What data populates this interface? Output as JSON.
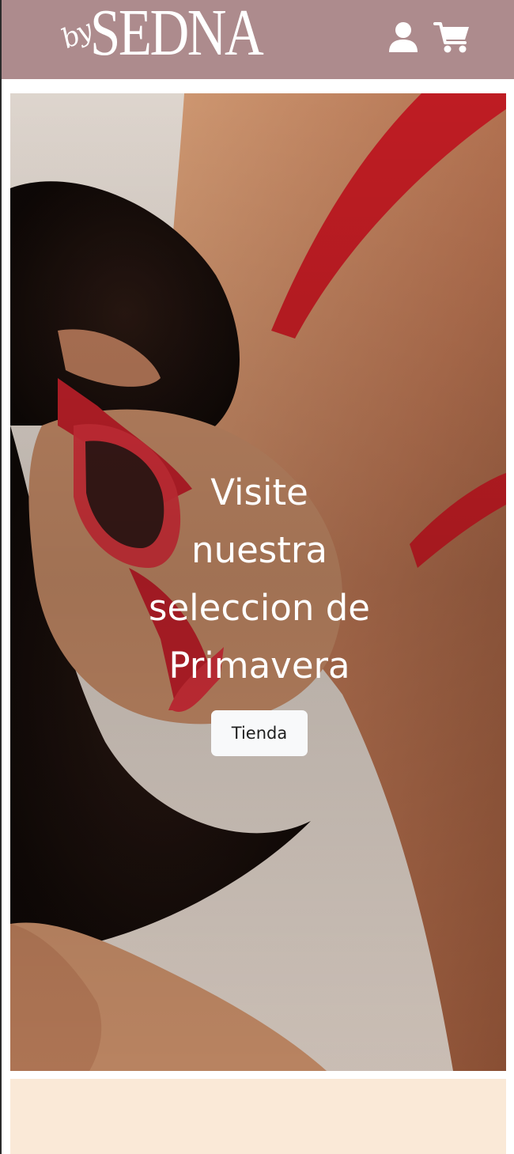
{
  "brand": {
    "logo_prefix": "by",
    "logo_name": "SEDNA"
  },
  "header": {
    "background": "#ad8b8d",
    "icons": [
      "user-icon",
      "shopping-cart-icon"
    ]
  },
  "hero": {
    "title_lines": [
      "Visite",
      "nuestra",
      "seleccion de",
      "Primavera"
    ],
    "button_label": "Tienda"
  },
  "colors": {
    "accent_red": "#d42528",
    "footer_band": "#fae9d7"
  }
}
